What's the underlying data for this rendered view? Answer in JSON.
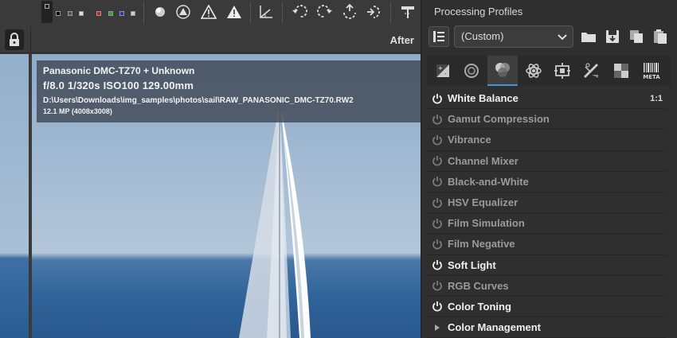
{
  "toolbar": {
    "swatch_colors": [
      "#000000",
      "#555555",
      "#999999",
      "#ffffff",
      "#cc2222",
      "#22aa22",
      "#2233cc",
      "#cccccc"
    ]
  },
  "preview": {
    "after_label": "After"
  },
  "info": {
    "camera": "Panasonic DMC-TZ70 + Unknown",
    "exposure": "f/8.0  1/320s  ISO100  129.00mm",
    "path": "D:\\Users\\Downloads\\img_samples\\photos\\sail\\RAW_PANASONIC_DMC-TZ70.RW2",
    "megapixels": "12.1 MP (4008x3008)"
  },
  "processing_profiles": {
    "title": "Processing Profiles",
    "selected_profile": "(Custom)"
  },
  "tool_tabs": [
    "exposure",
    "detail",
    "color",
    "advanced",
    "transform",
    "raw",
    "locallab",
    "metadata"
  ],
  "tool_tabs_meta_label": "META",
  "tools": [
    {
      "label": "White Balance",
      "enabled": true,
      "right": "1:1"
    },
    {
      "label": "Gamut Compression",
      "enabled": false
    },
    {
      "label": "Vibrance",
      "enabled": false
    },
    {
      "label": "Channel Mixer",
      "enabled": false
    },
    {
      "label": "Black-and-White",
      "enabled": false
    },
    {
      "label": "HSV Equalizer",
      "enabled": false
    },
    {
      "label": "Film Simulation",
      "enabled": false
    },
    {
      "label": "Film Negative",
      "enabled": false
    },
    {
      "label": "Soft Light",
      "enabled": true
    },
    {
      "label": "RGB Curves",
      "enabled": false
    },
    {
      "label": "Color Toning",
      "enabled": true
    },
    {
      "label": "Color Management",
      "enabled": true,
      "expander": true
    }
  ],
  "colors": {
    "accent": "#4a90d9",
    "panel_bg": "#2f2f2f",
    "sky": "#a3bbd3",
    "sea": "#2f6299"
  }
}
